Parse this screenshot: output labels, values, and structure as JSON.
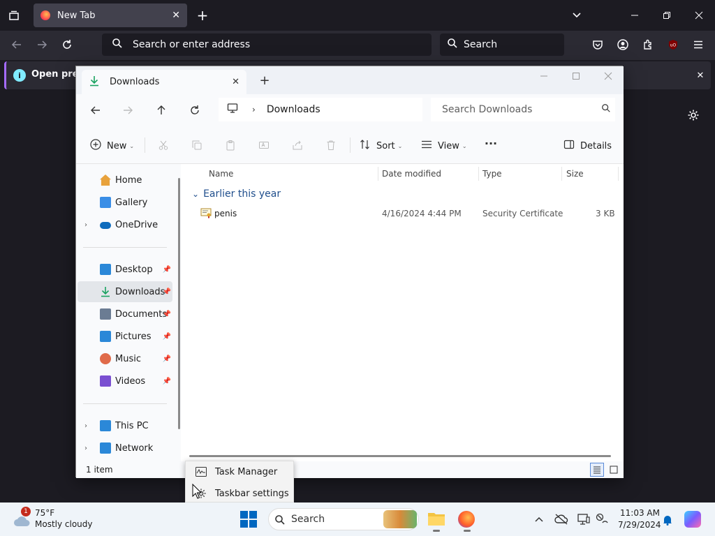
{
  "browser": {
    "tab_title": "New Tab",
    "url_placeholder": "Search or enter address",
    "search_placeholder": "Search",
    "notice_text": "Open previ"
  },
  "explorer": {
    "tab_title": "Downloads",
    "breadcrumb": "Downloads",
    "search_placeholder": "Search Downloads",
    "commands": {
      "new": "New",
      "sort": "Sort",
      "view": "View",
      "details": "Details"
    },
    "sidebar": [
      {
        "label": "Home",
        "icon": "home-icon",
        "color": "#e8a23c"
      },
      {
        "label": "Gallery",
        "icon": "gallery-icon",
        "color": "#3a8ee6"
      },
      {
        "label": "OneDrive",
        "icon": "onedrive-icon",
        "color": "#0f6cbd"
      },
      {
        "label": "Desktop",
        "icon": "desktop-icon",
        "color": "#2b88d8"
      },
      {
        "label": "Downloads",
        "icon": "downloads-icon",
        "color": "#1aa260"
      },
      {
        "label": "Documents",
        "icon": "documents-icon",
        "color": "#6b7c93"
      },
      {
        "label": "Pictures",
        "icon": "pictures-icon",
        "color": "#2b88d8"
      },
      {
        "label": "Music",
        "icon": "music-icon",
        "color": "#e06b4a"
      },
      {
        "label": "Videos",
        "icon": "videos-icon",
        "color": "#7a4fd1"
      },
      {
        "label": "This PC",
        "icon": "this-pc-icon",
        "color": "#2b88d8"
      },
      {
        "label": "Network",
        "icon": "network-icon",
        "color": "#2b88d8"
      }
    ],
    "columns": {
      "name": "Name",
      "date": "Date modified",
      "type": "Type",
      "size": "Size"
    },
    "group_header": "Earlier this year",
    "files": [
      {
        "name": "penis",
        "date": "4/16/2024 4:44 PM",
        "type": "Security Certificate",
        "size": "3 KB"
      }
    ],
    "status": "1 item"
  },
  "context_menu": {
    "items": [
      "Task Manager",
      "Taskbar settings"
    ]
  },
  "taskbar": {
    "weather_temp": "75°F",
    "weather_desc": "Mostly cloudy",
    "weather_badge": "1",
    "search_placeholder": "Search",
    "time": "11:03 AM",
    "date": "7/29/2024"
  }
}
